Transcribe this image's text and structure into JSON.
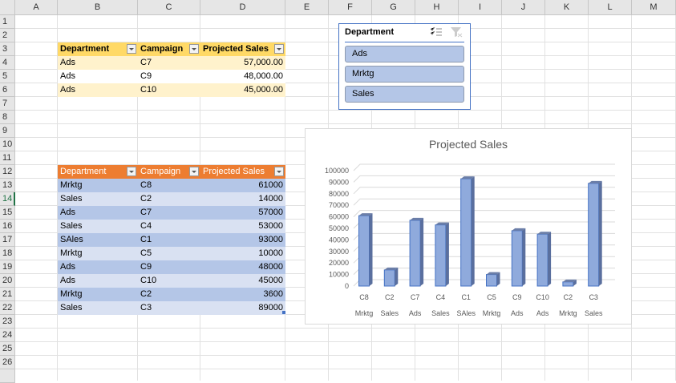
{
  "columns": [
    "A",
    "B",
    "C",
    "D",
    "E",
    "F",
    "G",
    "H",
    "I",
    "J",
    "K",
    "L",
    "M"
  ],
  "rows": [
    "1",
    "2",
    "3",
    "4",
    "5",
    "6",
    "7",
    "8",
    "9",
    "10",
    "11",
    "12",
    "13",
    "14",
    "15",
    "16",
    "17",
    "18",
    "19",
    "20",
    "21",
    "22",
    "23",
    "24",
    "25",
    "26"
  ],
  "filtered_table": {
    "headers": [
      "Department",
      "Campaign",
      "Projected Sales"
    ],
    "rows": [
      [
        "Ads",
        "C7",
        "57,000.00"
      ],
      [
        "Ads",
        "C9",
        "48,000.00"
      ],
      [
        "Ads",
        "C10",
        "45,000.00"
      ]
    ],
    "header_color": "#ffd966",
    "band_color": "#fff2cc"
  },
  "source_table": {
    "headers": [
      "Department",
      "Campaign",
      "Projected Sales"
    ],
    "rows": [
      [
        "Mrktg",
        "C8",
        "61000"
      ],
      [
        "Sales",
        "C2",
        "14000"
      ],
      [
        "Ads",
        "C7",
        "57000"
      ],
      [
        "Sales",
        "C4",
        "53000"
      ],
      [
        "SAles",
        "C1",
        "93000"
      ],
      [
        "Mrktg",
        "C5",
        "10000"
      ],
      [
        "Ads",
        "C9",
        "48000"
      ],
      [
        "Ads",
        "C10",
        "45000"
      ],
      [
        "Mrktg",
        "C2",
        "3600"
      ],
      [
        "Sales",
        "C3",
        "89000"
      ]
    ],
    "header_color": "#ed7d31",
    "band_dark": "#b4c6e7",
    "band_light": "#d9e1f2"
  },
  "slicer": {
    "title": "Department",
    "items": [
      "Ads",
      "Mrktg",
      "Sales"
    ],
    "icons": [
      "multi-select-icon",
      "clear-filter-icon"
    ]
  },
  "chart_data": {
    "type": "bar",
    "title": "Projected Sales",
    "categories": [
      [
        "C8",
        "Mrktg"
      ],
      [
        "C2",
        "Sales"
      ],
      [
        "C7",
        "Ads"
      ],
      [
        "C4",
        "Sales"
      ],
      [
        "C1",
        "SAles"
      ],
      [
        "C5",
        "Mrktg"
      ],
      [
        "C9",
        "Ads"
      ],
      [
        "C10",
        "Ads"
      ],
      [
        "C2",
        "Mrktg"
      ],
      [
        "C3",
        "Sales"
      ]
    ],
    "values": [
      61000,
      14000,
      57000,
      53000,
      93000,
      10000,
      48000,
      45000,
      3600,
      89000
    ],
    "ylim": [
      0,
      100000
    ],
    "yticks": [
      "0",
      "10000",
      "20000",
      "30000",
      "40000",
      "50000",
      "60000",
      "70000",
      "80000",
      "90000",
      "100000"
    ],
    "bar_color": "#8faadc"
  }
}
